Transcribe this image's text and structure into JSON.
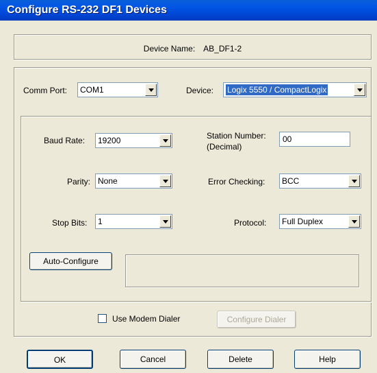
{
  "window": {
    "title": "Configure RS-232 DF1 Devices"
  },
  "device_name": {
    "label": "Device Name:",
    "value": "AB_DF1-2"
  },
  "comm_port": {
    "label": "Comm Port:",
    "value": "COM1"
  },
  "device": {
    "label": "Device:",
    "value": "Logix 5550 / CompactLogix"
  },
  "settings": {
    "baud_rate": {
      "label": "Baud Rate:",
      "value": "19200"
    },
    "station_number": {
      "label_line1": "Station Number:",
      "label_line2": "(Decimal)",
      "value": "00"
    },
    "parity": {
      "label": "Parity:",
      "value": "None"
    },
    "error_checking": {
      "label": "Error Checking:",
      "value": "BCC"
    },
    "stop_bits": {
      "label": "Stop Bits:",
      "value": "1"
    },
    "protocol": {
      "label": "Protocol:",
      "value": "Full Duplex"
    },
    "auto_configure_label": "Auto-Configure"
  },
  "modem": {
    "use_modem_dialer_label": "Use Modem Dialer",
    "use_modem_dialer_checked": false,
    "configure_dialer_label": "Configure Dialer"
  },
  "buttons": {
    "ok": "OK",
    "cancel": "Cancel",
    "delete": "Delete",
    "help": "Help"
  }
}
